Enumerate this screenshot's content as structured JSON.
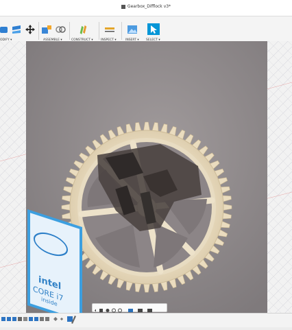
{
  "window": {
    "title": "Gearbox_Difflock v3*"
  },
  "toolbar": {
    "groups": [
      {
        "label": "ODIFY ▾"
      },
      {
        "label": "ASSEMBLE ▾"
      },
      {
        "label": "CONSTRUCT ▾"
      },
      {
        "label": "INSPECT ▾"
      },
      {
        "label": "INSERT ▾"
      },
      {
        "label": "SELECT ▾"
      }
    ]
  },
  "viewport": {
    "badge": {
      "brand": "intel",
      "line1": "CORE i7",
      "line2": "inside"
    }
  },
  "colors": {
    "accent": "#0696d7",
    "toolbar_bg": "#f4f4f4"
  }
}
